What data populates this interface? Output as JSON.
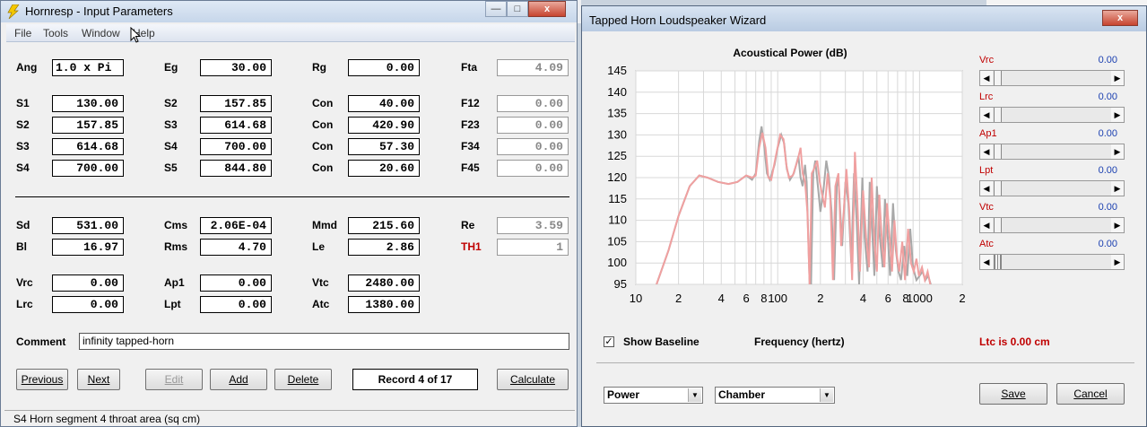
{
  "background": {
    "window_x_label": "x"
  },
  "win1": {
    "title": "Hornresp - Input Parameters",
    "menu": [
      "File",
      "Tools",
      "Window",
      "Help"
    ],
    "rows_top": [
      [
        [
          "Ang",
          "1.0 x Pi",
          false,
          true
        ],
        [
          "Eg",
          "30.00",
          false,
          false
        ],
        [
          "Rg",
          "0.00",
          false,
          false
        ],
        [
          "Fta",
          "4.09",
          false,
          false
        ]
      ],
      [
        [
          "S1",
          "130.00",
          false,
          false
        ],
        [
          "S2",
          "157.85",
          false,
          false
        ],
        [
          "Con",
          "40.00",
          false,
          false
        ],
        [
          "F12",
          "0.00",
          false,
          false
        ]
      ],
      [
        [
          "S2",
          "157.85",
          false,
          false
        ],
        [
          "S3",
          "614.68",
          false,
          false
        ],
        [
          "Con",
          "420.90",
          false,
          false
        ],
        [
          "F23",
          "0.00",
          false,
          false
        ]
      ],
      [
        [
          "S3",
          "614.68",
          false,
          false
        ],
        [
          "S4",
          "700.00",
          false,
          false
        ],
        [
          "Con",
          "57.30",
          false,
          false
        ],
        [
          "F34",
          "0.00",
          false,
          false
        ]
      ],
      [
        [
          "S4",
          "700.00",
          false,
          false
        ],
        [
          "S5",
          "844.80",
          false,
          false
        ],
        [
          "Con",
          "20.60",
          false,
          false
        ],
        [
          "F45",
          "0.00",
          false,
          false
        ]
      ]
    ],
    "rows_mid": [
      [
        [
          "Sd",
          "531.00",
          false,
          false
        ],
        [
          "Cms",
          "2.06E-04",
          false,
          false
        ],
        [
          "Mmd",
          "215.60",
          false,
          false
        ],
        [
          "Re",
          "3.59",
          false,
          false
        ]
      ],
      [
        [
          "Bl",
          "16.97",
          false,
          false
        ],
        [
          "Rms",
          "4.70",
          false,
          false
        ],
        [
          "Le",
          "2.86",
          false,
          false
        ],
        [
          "TH1",
          "1",
          true,
          false
        ]
      ],
      [
        [
          "Vrc",
          "0.00",
          false,
          false
        ],
        [
          "Ap1",
          "0.00",
          false,
          false
        ],
        [
          "Vtc",
          "2480.00",
          false,
          false
        ]
      ],
      [
        [
          "Lrc",
          "0.00",
          false,
          false
        ],
        [
          "Lpt",
          "0.00",
          false,
          false
        ],
        [
          "Atc",
          "1380.00",
          false,
          false
        ]
      ]
    ],
    "comment_label": "Comment",
    "comment_value": "infinity tapped-horn",
    "buttons": {
      "previous": "Previous",
      "next": "Next",
      "edit": "Edit",
      "add": "Add",
      "delete": "Delete",
      "calculate": "Calculate"
    },
    "record": "Record 4 of 17",
    "status": "S4   Horn segment 4 throat area  (sq cm)"
  },
  "win2": {
    "title": "Tapped Horn Loudspeaker Wizard",
    "close_label": "x",
    "show_baseline": "Show Baseline",
    "show_baseline_checked": true,
    "ltc_text": "Ltc is 0.00 cm",
    "sliders": [
      {
        "name": "Vrc",
        "value": "0.00",
        "position": 0.0
      },
      {
        "name": "Lrc",
        "value": "0.00",
        "position": 0.0
      },
      {
        "name": "Ap1",
        "value": "0.00",
        "position": 0.0
      },
      {
        "name": "Lpt",
        "value": "0.00",
        "position": 0.0
      },
      {
        "name": "Vtc",
        "value": "0.00",
        "position": 0.0
      },
      {
        "name": "Atc",
        "value": "0.00",
        "position": 0.0
      }
    ],
    "select_type": "Power",
    "select_mode": "Chamber",
    "save_label": "Save",
    "cancel_label": "Cancel",
    "colors": {
      "baseline": "#a8a8a8",
      "current": "#f0a0a0",
      "label_red": "#c00000",
      "value_blue": "#1a3fb0"
    }
  },
  "chart_data": {
    "type": "line",
    "title": "Acoustical Power (dB)",
    "xlabel": "Frequency (hertz)",
    "ylabel": "",
    "x_scale": "log",
    "xlim": [
      10,
      2000
    ],
    "ylim": [
      95,
      145
    ],
    "grid": true,
    "y_ticks": [
      95,
      100,
      105,
      110,
      115,
      120,
      125,
      130,
      135,
      140,
      145
    ],
    "x_tick_labels": [
      {
        "x": 10,
        "label": "10"
      },
      {
        "x": 20,
        "label": "2"
      },
      {
        "x": 40,
        "label": "4"
      },
      {
        "x": 60,
        "label": "6"
      },
      {
        "x": 80,
        "label": "8"
      },
      {
        "x": 100,
        "label": "100"
      },
      {
        "x": 200,
        "label": "2"
      },
      {
        "x": 400,
        "label": "4"
      },
      {
        "x": 600,
        "label": "6"
      },
      {
        "x": 800,
        "label": "8"
      },
      {
        "x": 1000,
        "label": "1000"
      },
      {
        "x": 2000,
        "label": "2"
      }
    ],
    "series": [
      {
        "color": "#a8a8a8",
        "points": [
          [
            14,
            95
          ],
          [
            17,
            103
          ],
          [
            20,
            111
          ],
          [
            24,
            118
          ],
          [
            28,
            120.5
          ],
          [
            32,
            120
          ],
          [
            38,
            119
          ],
          [
            45,
            118.5
          ],
          [
            52,
            119
          ],
          [
            60,
            120.5
          ],
          [
            66,
            119.5
          ],
          [
            70,
            121
          ],
          [
            74,
            128.5
          ],
          [
            77,
            132
          ],
          [
            80,
            128
          ],
          [
            84,
            121
          ],
          [
            88,
            119.5
          ],
          [
            95,
            123
          ],
          [
            100,
            127
          ],
          [
            106,
            130
          ],
          [
            111,
            128
          ],
          [
            116,
            122
          ],
          [
            122,
            119.5
          ],
          [
            130,
            121
          ],
          [
            140,
            125
          ],
          [
            145,
            120
          ],
          [
            150,
            118
          ],
          [
            156,
            123
          ],
          [
            160,
            119
          ],
          [
            168,
            95
          ],
          [
            172,
            95
          ],
          [
            178,
            121
          ],
          [
            184,
            124
          ],
          [
            192,
            118
          ],
          [
            200,
            112
          ],
          [
            210,
            117
          ],
          [
            220,
            124
          ],
          [
            230,
            120
          ],
          [
            240,
            112
          ],
          [
            250,
            96
          ],
          [
            262,
            120
          ],
          [
            270,
            118
          ],
          [
            285,
            104
          ],
          [
            300,
            119
          ],
          [
            315,
            114
          ],
          [
            330,
            100
          ],
          [
            345,
            121
          ],
          [
            360,
            110
          ],
          [
            375,
            95
          ],
          [
            395,
            120
          ],
          [
            410,
            106
          ],
          [
            430,
            98
          ],
          [
            445,
            119
          ],
          [
            460,
            110
          ],
          [
            480,
            97
          ],
          [
            500,
            118
          ],
          [
            525,
            106
          ],
          [
            550,
            99
          ],
          [
            570,
            115
          ],
          [
            600,
            105
          ],
          [
            620,
            97
          ],
          [
            650,
            114
          ],
          [
            680,
            103
          ],
          [
            710,
            98
          ],
          [
            740,
            96
          ],
          [
            780,
            104
          ],
          [
            820,
            97
          ],
          [
            860,
            108
          ],
          [
            900,
            99
          ],
          [
            950,
            96
          ],
          [
            1000,
            97
          ],
          [
            1050,
            98
          ],
          [
            1100,
            96
          ],
          [
            1150,
            97
          ],
          [
            1200,
            95
          ]
        ]
      },
      {
        "color": "#f0a0a0",
        "points": [
          [
            14,
            95
          ],
          [
            17,
            103
          ],
          [
            20,
            111
          ],
          [
            24,
            118
          ],
          [
            28,
            120.5
          ],
          [
            32,
            120
          ],
          [
            38,
            119
          ],
          [
            45,
            118.5
          ],
          [
            52,
            119
          ],
          [
            60,
            120.5
          ],
          [
            66,
            120
          ],
          [
            70,
            120.5
          ],
          [
            74,
            127
          ],
          [
            78,
            130.5
          ],
          [
            82,
            127
          ],
          [
            86,
            120
          ],
          [
            90,
            119.5
          ],
          [
            97,
            125
          ],
          [
            104,
            130
          ],
          [
            110,
            129
          ],
          [
            115,
            123
          ],
          [
            120,
            120
          ],
          [
            128,
            120.5
          ],
          [
            138,
            124
          ],
          [
            145,
            127
          ],
          [
            150,
            121
          ],
          [
            156,
            119
          ],
          [
            162,
            112
          ],
          [
            168,
            95
          ],
          [
            174,
            121
          ],
          [
            180,
            122
          ],
          [
            190,
            124
          ],
          [
            198,
            119
          ],
          [
            206,
            116
          ],
          [
            215,
            113
          ],
          [
            225,
            121
          ],
          [
            235,
            115
          ],
          [
            245,
            96
          ],
          [
            255,
            118
          ],
          [
            268,
            121
          ],
          [
            280,
            104
          ],
          [
            292,
            112
          ],
          [
            305,
            122
          ],
          [
            320,
            112
          ],
          [
            335,
            96
          ],
          [
            350,
            126
          ],
          [
            365,
            114
          ],
          [
            380,
            98
          ],
          [
            400,
            117
          ],
          [
            420,
            106
          ],
          [
            440,
            99
          ],
          [
            460,
            120
          ],
          [
            480,
            105
          ],
          [
            500,
            98
          ],
          [
            520,
            116
          ],
          [
            545,
            104
          ],
          [
            565,
            99
          ],
          [
            590,
            114
          ],
          [
            615,
            106
          ],
          [
            640,
            98
          ],
          [
            665,
            110
          ],
          [
            690,
            102
          ],
          [
            720,
            98
          ],
          [
            755,
            105
          ],
          [
            790,
            96
          ],
          [
            830,
            108
          ],
          [
            870,
            100
          ],
          [
            910,
            98
          ],
          [
            950,
            101
          ],
          [
            990,
            97
          ],
          [
            1040,
            99
          ],
          [
            1090,
            96
          ],
          [
            1140,
            98
          ],
          [
            1190,
            95
          ]
        ]
      }
    ]
  }
}
